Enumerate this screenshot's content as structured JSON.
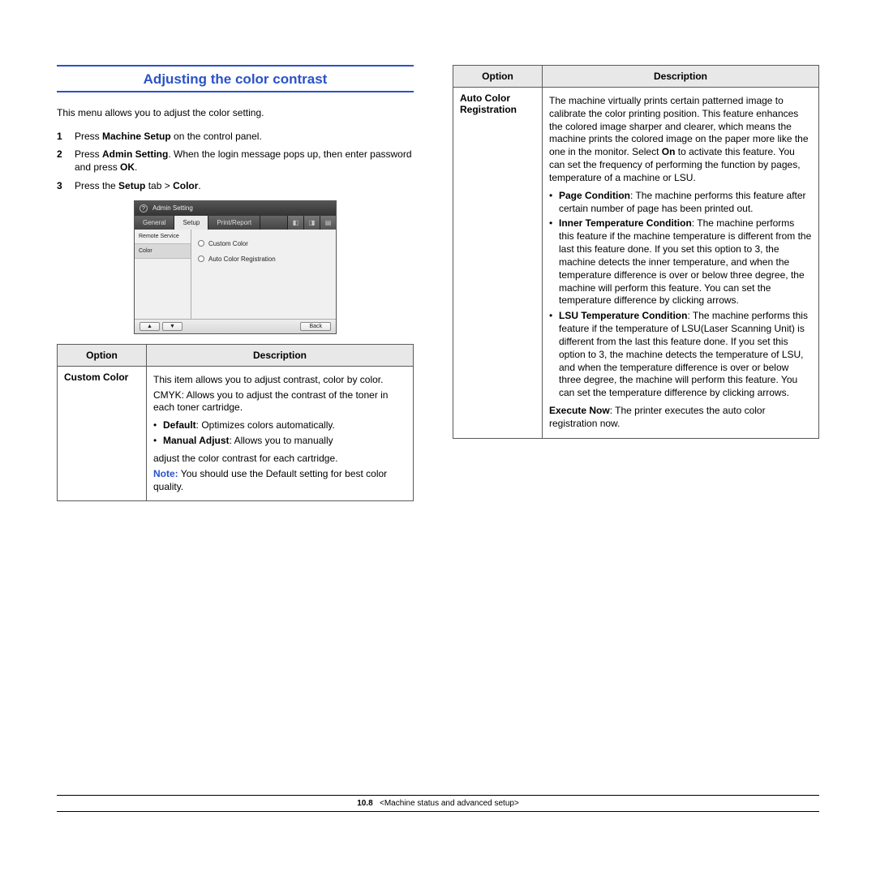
{
  "heading": "Adjusting the color contrast",
  "intro": "This menu allows you to adjust the color setting.",
  "steps": [
    {
      "num": "1",
      "pre": "Press ",
      "bold1": "Machine Setup",
      "rest": " on the control panel."
    },
    {
      "num": "2",
      "pre": "Press ",
      "bold1": "Admin Setting",
      "mid": ". When the login message pops up, then enter password and press ",
      "bold2": "OK",
      "rest": "."
    },
    {
      "num": "3",
      "pre": "Press the ",
      "bold1": "Setup",
      "mid": " tab > ",
      "bold2": "Color",
      "rest": "."
    }
  ],
  "ui": {
    "title": "Admin Setting",
    "tabs": {
      "general": "General",
      "setup": "Setup",
      "print": "Print/Report"
    },
    "side": {
      "remote": "Remote Service",
      "color": "Color"
    },
    "opts": {
      "custom": "Custom Color",
      "auto": "Auto Color Registration"
    },
    "back": "Back",
    "nav_up": "▲",
    "nav_dn": "▼"
  },
  "table1": {
    "head_opt": "Option",
    "head_desc": "Description",
    "row1": {
      "name": "Custom Color",
      "p1": "This item allows you to adjust contrast, color by color.",
      "p2": "CMYK: Allows you to adjust the contrast of the toner in each toner cartridge.",
      "li1b": "Default",
      "li1r": ": Optimizes colors automatically.",
      "li2b": "Manual Adjust",
      "li2r": ": Allows you to manually",
      "p3": "adjust the color contrast for each cartridge.",
      "note_word": "Note:",
      "note_rest": " You should use the Default setting for best color quality."
    }
  },
  "table2": {
    "head_opt": "Option",
    "head_desc": "Description",
    "row1": {
      "name": "Auto Color Registration",
      "intro_pre": "The machine virtually prints certain patterned image to calibrate the color printing position. This feature enhances the colored image sharper and clearer, which means the machine prints the colored image on the paper more like the one in the monitor. Select ",
      "intro_b": "On",
      "intro_post": " to activate this feature. You can set the frequency of performing the function by pages, temperature of a machine or LSU.",
      "li1b": "Page Condition",
      "li1r": ": The machine performs this feature after certain number of page has been printed out.",
      "li2b": "Inner Temperature Condition",
      "li2r": ": The machine performs this feature if the machine temperature is different from the last this feature done. If you set this option to 3, the machine detects the inner temperature, and when the temperature difference is over or below three degree, the machine will perform this feature. You can set the temperature difference by clicking arrows.",
      "li3b": "LSU Temperature Condition",
      "li3r": ": The machine performs this feature if the temperature of LSU(Laser Scanning Unit) is different from the last this feature done. If you set this option to 3, the machine detects the temperature of LSU, and when the temperature difference is over or below three degree, the machine will perform this feature. You can set the temperature difference by clicking arrows.",
      "exec_b": "Execute Now",
      "exec_r": ": The printer executes the auto color registration now."
    }
  },
  "footer": {
    "page": "10.8",
    "chapter": "<Machine status and advanced setup>"
  }
}
